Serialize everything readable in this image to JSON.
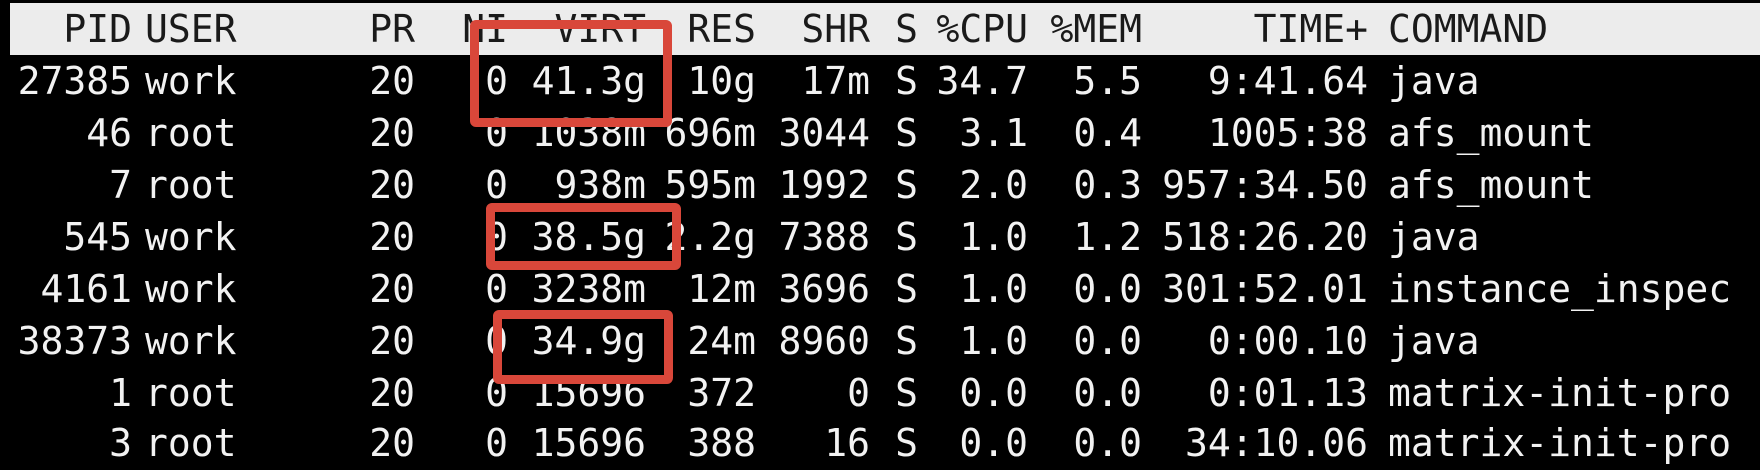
{
  "window": {
    "title": ""
  },
  "columns": {
    "pid": "PID",
    "user": "USER",
    "pr": "PR",
    "ni": "NI",
    "virt": "VIRT",
    "res": "RES",
    "shr": "SHR",
    "s": "S",
    "cpu": "%CPU",
    "mem": "%MEM",
    "time": "TIME+",
    "command": "COMMAND"
  },
  "processes": [
    {
      "pid": "27385",
      "user": "work",
      "pr": "20",
      "ni": "0",
      "virt": "41.3g",
      "res": "10g",
      "shr": "17m",
      "s": "S",
      "cpu": "34.7",
      "mem": "5.5",
      "time": "9:41.64",
      "command": "java"
    },
    {
      "pid": "46",
      "user": "root",
      "pr": "20",
      "ni": "0",
      "virt": "1038m",
      "res": "696m",
      "shr": "3044",
      "s": "S",
      "cpu": "3.1",
      "mem": "0.4",
      "time": "1005:38",
      "command": "afs_mount"
    },
    {
      "pid": "7",
      "user": "root",
      "pr": "20",
      "ni": "0",
      "virt": "938m",
      "res": "595m",
      "shr": "1992",
      "s": "S",
      "cpu": "2.0",
      "mem": "0.3",
      "time": "957:34.50",
      "command": "afs_mount"
    },
    {
      "pid": "545",
      "user": "work",
      "pr": "20",
      "ni": "0",
      "virt": "38.5g",
      "res": "2.2g",
      "shr": "7388",
      "s": "S",
      "cpu": "1.0",
      "mem": "1.2",
      "time": "518:26.20",
      "command": "java"
    },
    {
      "pid": "4161",
      "user": "work",
      "pr": "20",
      "ni": "0",
      "virt": "3238m",
      "res": "12m",
      "shr": "3696",
      "s": "S",
      "cpu": "1.0",
      "mem": "0.0",
      "time": "301:52.01",
      "command": "instance_inspec"
    },
    {
      "pid": "38373",
      "user": "work",
      "pr": "20",
      "ni": "0",
      "virt": "34.9g",
      "res": "24m",
      "shr": "8960",
      "s": "S",
      "cpu": "1.0",
      "mem": "0.0",
      "time": "0:00.10",
      "command": "java"
    },
    {
      "pid": "1",
      "user": "root",
      "pr": "20",
      "ni": "0",
      "virt": "15696",
      "res": "372",
      "shr": "0",
      "s": "S",
      "cpu": "0.0",
      "mem": "0.0",
      "time": "0:01.13",
      "command": "matrix-init-pro"
    },
    {
      "pid": "3",
      "user": "root",
      "pr": "20",
      "ni": "0",
      "virt": "15696",
      "res": "388",
      "shr": "16",
      "s": "S",
      "cpu": "0.0",
      "mem": "0.0",
      "time": "34:10.06",
      "command": "matrix-init-pro"
    }
  ],
  "colors": {
    "background": "#000000",
    "header_background": "#ececec",
    "header_text": "#1a1a1a",
    "row_text": "#f2f2f2",
    "highlight": "#d9473a"
  },
  "highlighted_rows": [
    "27385",
    "545",
    "38373"
  ]
}
